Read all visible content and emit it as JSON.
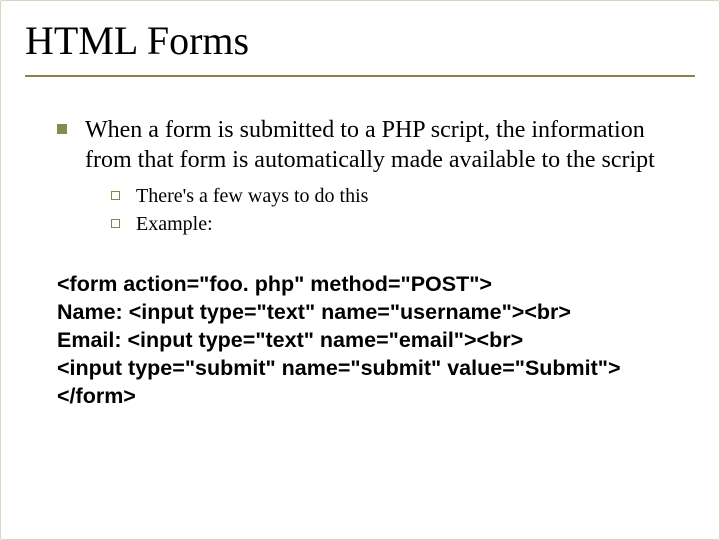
{
  "title": "HTML Forms",
  "bullet1": "When a form is submitted to a PHP script, the information from that form is automatically made available to the script",
  "sub1": "There's a few ways to do this",
  "sub2": "Example:",
  "code": {
    "l1": "<form action=\"foo. php\" method=\"POST\">",
    "l2": "Name: <input type=\"text\" name=\"username\"><br>",
    "l3": "Email: <input type=\"text\" name=\"email\"><br>",
    "l4": "<input type=\"submit\" name=\"submit\" value=\"Submit\">",
    "l5": "</form>"
  }
}
